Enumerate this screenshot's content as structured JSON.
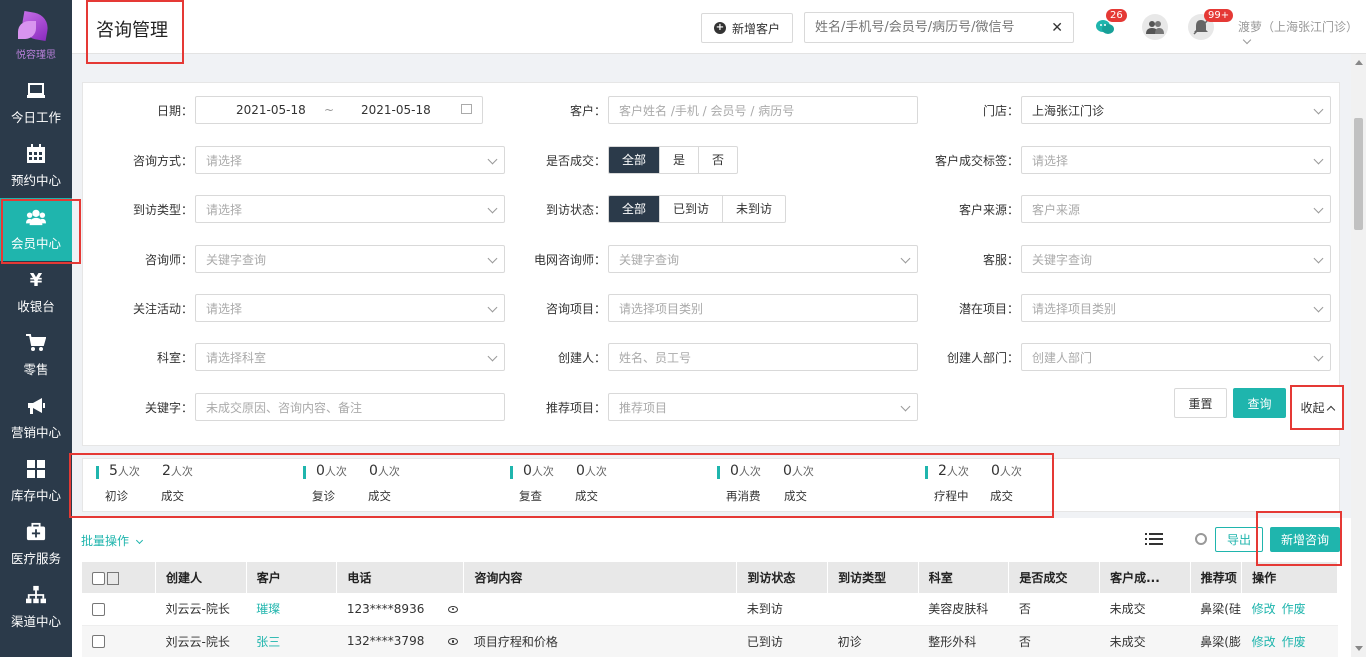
{
  "brand": {
    "logo_text": "悦容瑾思"
  },
  "nav": [
    {
      "label": "今日工作",
      "icon": "monitor-icon"
    },
    {
      "label": "预约中心",
      "icon": "calendar-icon"
    },
    {
      "label": "会员中心",
      "icon": "users-icon",
      "active": true
    },
    {
      "label": "收银台",
      "icon": "yen-icon"
    },
    {
      "label": "零售",
      "icon": "cart-icon"
    },
    {
      "label": "营销中心",
      "icon": "megaphone-icon"
    },
    {
      "label": "库存中心",
      "icon": "grid-icon"
    },
    {
      "label": "医疗服务",
      "icon": "medkit-icon"
    },
    {
      "label": "渠道中心",
      "icon": "sitemap-icon"
    }
  ],
  "header": {
    "title": "咨询管理",
    "new_customer_label": "新增客户",
    "search_placeholder": "姓名/手机号/会员号/病历号/微信号",
    "wechat_badge": "26",
    "bell_badge": "99+",
    "user": "渡萝（上海张江门诊）"
  },
  "filters": {
    "date_label": "日期：",
    "date_from": "2021-05-18",
    "date_sep": "~",
    "date_to": "2021-05-18",
    "customer_label": "客户：",
    "customer_placeholder": "客户姓名 /手机 / 会员号 / 病历号",
    "store_label": "门店：",
    "store_value": "上海张江门诊",
    "method_label": "咨询方式：",
    "method_placeholder": "请选择",
    "deal_label": "是否成交：",
    "deal_options": [
      "全部",
      "是",
      "否"
    ],
    "deal_tag_label": "客户成交标签：",
    "deal_tag_placeholder": "请选择",
    "visit_type_label": "到访类型：",
    "visit_type_placeholder": "请选择",
    "visit_status_label": "到访状态：",
    "visit_status_options": [
      "全部",
      "已到访",
      "未到访"
    ],
    "source_label": "客户来源：",
    "source_placeholder": "客户来源",
    "consultant_label": "咨询师：",
    "consultant_placeholder": "关键字查询",
    "online_consultant_label": "电网咨询师：",
    "online_consultant_placeholder": "关键字查询",
    "service_label": "客服：",
    "service_placeholder": "关键字查询",
    "activity_label": "关注活动：",
    "activity_placeholder": "请选择",
    "item_label": "咨询项目：",
    "item_placeholder": "请选择项目类别",
    "potential_label": "潜在项目：",
    "potential_placeholder": "请选择项目类别",
    "dept_label": "科室：",
    "dept_placeholder": "请选择科室",
    "creator_label": "创建人：",
    "creator_placeholder": "姓名、员工号",
    "creator_dept_label": "创建人部门：",
    "creator_dept_placeholder": "创建人部门",
    "keyword_label": "关键字：",
    "keyword_placeholder": "未成交原因、咨询内容、备注",
    "recommend_label": "推荐项目：",
    "recommend_placeholder": "推荐项目",
    "reset_label": "重置",
    "query_label": "查询",
    "collapse_label": "收起"
  },
  "stats": [
    {
      "a_num": "5",
      "a_unit": "人次",
      "a_label": "初诊",
      "b_num": "2",
      "b_unit": "人次",
      "b_label": "成交"
    },
    {
      "a_num": "0",
      "a_unit": "人次",
      "a_label": "复诊",
      "b_num": "0",
      "b_unit": "人次",
      "b_label": "成交"
    },
    {
      "a_num": "0",
      "a_unit": "人次",
      "a_label": "复查",
      "b_num": "0",
      "b_unit": "人次",
      "b_label": "成交"
    },
    {
      "a_num": "0",
      "a_unit": "人次",
      "a_label": "再消费",
      "b_num": "0",
      "b_unit": "人次",
      "b_label": "成交"
    },
    {
      "a_num": "2",
      "a_unit": "人次",
      "a_label": "疗程中",
      "b_num": "0",
      "b_unit": "人次",
      "b_label": "成交"
    }
  ],
  "toolbar": {
    "batch_label": "批量操作",
    "export_label": "导出",
    "new_consult_label": "新增咨询"
  },
  "table": {
    "columns": [
      "创建人",
      "客户",
      "电话",
      "咨询内容",
      "到访状态",
      "到访类型",
      "科室",
      "是否成交",
      "客户成...",
      "推荐项",
      "操作"
    ],
    "rows": [
      {
        "creator": "刘云云-院长",
        "customer": "璀璨",
        "phone": "123****8936",
        "content": "",
        "visit_status": "未到访",
        "visit_type": "",
        "dept": "美容皮肤科",
        "deal": "否",
        "deal_tag": "未成交",
        "recommend": "鼻梁(硅",
        "edit": "修改",
        "void": "作废"
      },
      {
        "creator": "刘云云-院长",
        "customer": "张三",
        "phone": "132****3798",
        "content": "项目疗程和价格",
        "visit_status": "已到访",
        "visit_type": "初诊",
        "dept": "整形外科",
        "deal": "否",
        "deal_tag": "未成交",
        "recommend": "鼻梁(膨",
        "edit": "修改",
        "void": "作废"
      }
    ]
  }
}
